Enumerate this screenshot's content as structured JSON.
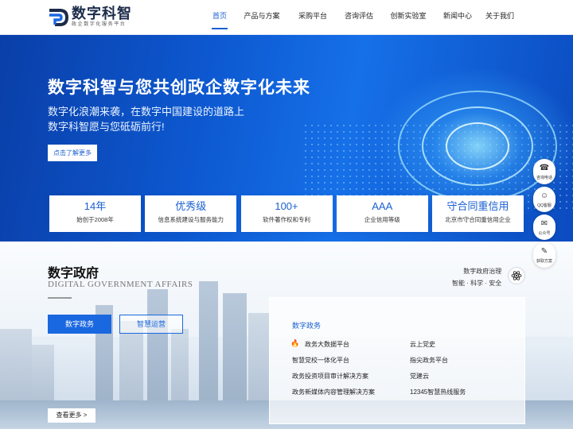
{
  "header": {
    "logo_title": "数字科智",
    "logo_sub": "政企数字化服务平台",
    "nav": [
      {
        "label": "首页",
        "active": true
      },
      {
        "label": "产品与方案"
      },
      {
        "label": "采购平台"
      },
      {
        "label": "咨询评估"
      },
      {
        "label": "创新实验室"
      },
      {
        "label": "新闻中心"
      },
      {
        "label": "关于我们"
      }
    ]
  },
  "hero": {
    "headline": "数字科智与您共创政企数字化未来",
    "line1": "数字化浪潮来袭，在数字中国建设的道路上",
    "line2": "数字科智愿与您砥砺前行!",
    "cta": "点击了解更多"
  },
  "stats": [
    {
      "value": "14年",
      "desc": "始创于2008年"
    },
    {
      "value": "优秀级",
      "desc": "信息系统建设与服务能力"
    },
    {
      "value": "100+",
      "desc": "软件著作权和专利"
    },
    {
      "value": "AAA",
      "desc": "企业信用等级"
    },
    {
      "value": "守合同重信用",
      "desc": "北京市守合同重信用企业"
    }
  ],
  "section": {
    "title": "数字政府",
    "subtitle": "DIGITAL GOVERNMENT AFFAIRS",
    "tag_line1": "数字政府治理",
    "tag_line2": "智能 · 科学 · 安全",
    "tab_active": "数字政务",
    "tab_other": "智慧运营",
    "more": "查看更多 >"
  },
  "panel": {
    "title": "数字政务",
    "items": [
      "政务大数据平台",
      "云上党史",
      "智慧党校一体化平台",
      "指尖政务平台",
      "政务投资项目审计解决方案",
      "党建云",
      "政务新媒体内容管理解决方案",
      "12345智慧热线服务"
    ]
  },
  "side": [
    {
      "label": "咨询电话",
      "icon": "phone-icon"
    },
    {
      "label": "QQ客服",
      "icon": "qq-icon"
    },
    {
      "label": "公众号",
      "icon": "wechat-icon"
    },
    {
      "label": "获取方案",
      "icon": "document-icon"
    }
  ],
  "colors": {
    "accent": "#1a5fd0",
    "hero_dark": "#0a3fa8",
    "hero_light": "#1670e8"
  }
}
